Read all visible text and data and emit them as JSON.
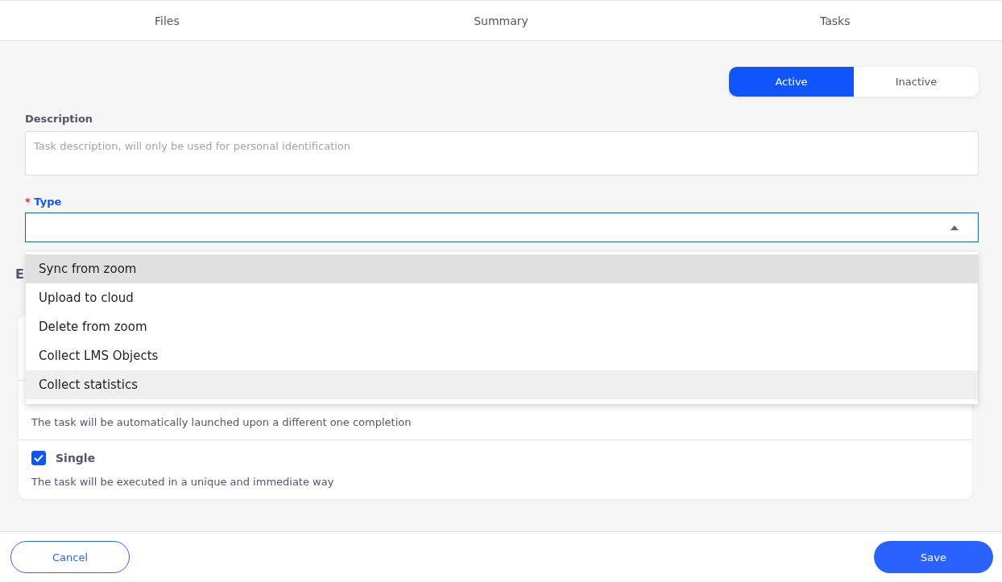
{
  "tabs": [
    {
      "label": "Files",
      "selected": false
    },
    {
      "label": "Summary",
      "selected": false
    },
    {
      "label": "Tasks",
      "selected": false
    }
  ],
  "status_toggle": [
    {
      "label": "Active",
      "selected": true
    },
    {
      "label": "Inactive",
      "selected": false
    }
  ],
  "description": {
    "label": "Description",
    "placeholder": "Task description, will only be used for personal identification"
  },
  "type": {
    "label": "Type",
    "required_mark": "*",
    "expanded": true,
    "options": [
      {
        "label": "Sync from zoom",
        "selected": true,
        "highlighted": false
      },
      {
        "label": "Upload to cloud",
        "selected": false,
        "highlighted": false
      },
      {
        "label": "Delete from zoom",
        "selected": false,
        "highlighted": false
      },
      {
        "label": "Collect LMS Objects",
        "selected": false,
        "highlighted": false
      },
      {
        "label": "Collect statistics",
        "selected": false,
        "highlighted": true
      }
    ]
  },
  "execution": {
    "heading": "E",
    "options": [
      {
        "kind": "note",
        "description": "The task will be automatically launched upon a different one completion"
      },
      {
        "kind": "checkbox",
        "label": "Single",
        "checked": true,
        "description": "The task will be executed in a unique and immediate way"
      }
    ]
  },
  "buttons": {
    "cancel": "Cancel",
    "save": "Save"
  }
}
